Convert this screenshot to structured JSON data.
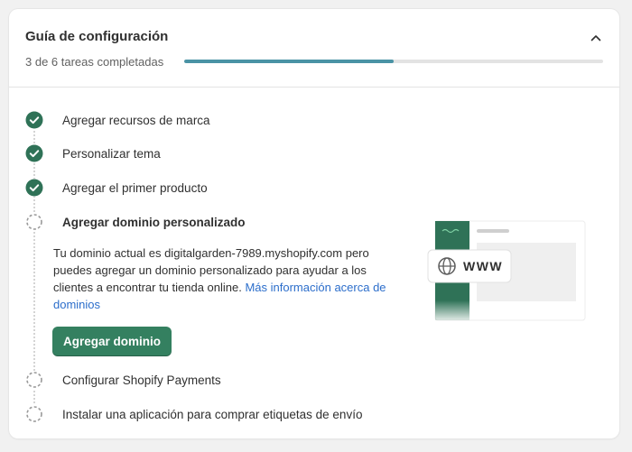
{
  "guide": {
    "title": "Guía de configuración",
    "progress_text": "3 de 6 tareas completadas",
    "progress_fraction": 0.5
  },
  "steps": [
    {
      "label": "Agregar recursos de marca",
      "status": "completed",
      "icon": "check-circle-icon"
    },
    {
      "label": "Personalizar tema",
      "status": "completed",
      "icon": "check-circle-icon"
    },
    {
      "label": "Agregar el primer producto",
      "status": "completed",
      "icon": "check-circle-icon"
    },
    {
      "label": "Agregar dominio personalizado",
      "status": "active",
      "icon": "dashed-circle-icon"
    },
    {
      "label": "Configurar Shopify Payments",
      "status": "pending",
      "icon": "dashed-circle-icon"
    },
    {
      "label": "Instalar una aplicación para comprar etiquetas de envío",
      "status": "pending",
      "icon": "dashed-circle-icon"
    }
  ],
  "active_step": {
    "description": "Tu dominio actual es digitalgarden-7989.myshopify.com pero puedes agregar un dominio personalizado para ayudar a los clientes a encontrar tu tienda online. ",
    "link_text": "Más información acerca de dominios",
    "button_label": "Agregar dominio",
    "illustration_text": "WWW"
  },
  "colors": {
    "accent_green": "#348060",
    "check_green": "#2f7257",
    "progress_fill": "#4a93a5",
    "link_blue": "#2c6ecb"
  }
}
